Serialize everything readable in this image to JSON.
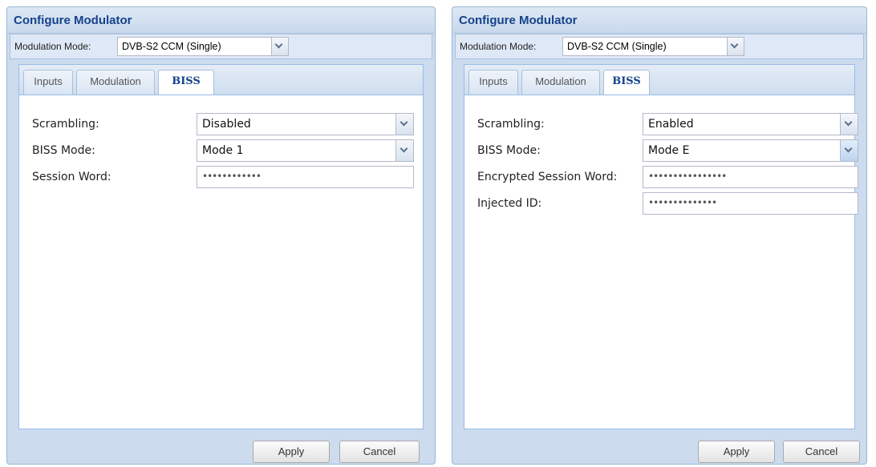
{
  "dialog_left": {
    "title": "Configure Modulator",
    "modulation_mode_label": "Modulation Mode:",
    "modulation_mode_value": "DVB-S2 CCM (Single)",
    "tabs": [
      "Inputs",
      "Modulation",
      "BISS"
    ],
    "active_tab": "BISS",
    "fields": {
      "scrambling_label": "Scrambling:",
      "scrambling_value": "Disabled",
      "biss_mode_label": "BISS Mode:",
      "biss_mode_value": "Mode 1",
      "session_word_label": "Session Word:",
      "session_word_value": "••••••••••••"
    },
    "apply_label": "Apply",
    "cancel_label": "Cancel"
  },
  "dialog_right": {
    "title": "Configure Modulator",
    "modulation_mode_label": "Modulation Mode:",
    "modulation_mode_value": "DVB-S2 CCM (Single)",
    "tabs": [
      "Inputs",
      "Modulation",
      "BISS"
    ],
    "active_tab": "BISS",
    "fields": {
      "scrambling_label": "Scrambling:",
      "scrambling_value": "Enabled",
      "biss_mode_label": "BISS Mode:",
      "biss_mode_value": "Mode E",
      "encrypted_session_word_label": "Encrypted Session Word:",
      "encrypted_session_word_value": "••••••••••••••••",
      "injected_id_label": "Injected ID:",
      "injected_id_value": "••••••••••••••"
    },
    "apply_label": "Apply",
    "cancel_label": "Cancel"
  },
  "colors": {
    "title_text": "#15428b",
    "dialog_bg": "#ccdcee",
    "panel_border": "#99bbe8"
  },
  "icons": {
    "dropdown": "chevron-down-icon"
  }
}
